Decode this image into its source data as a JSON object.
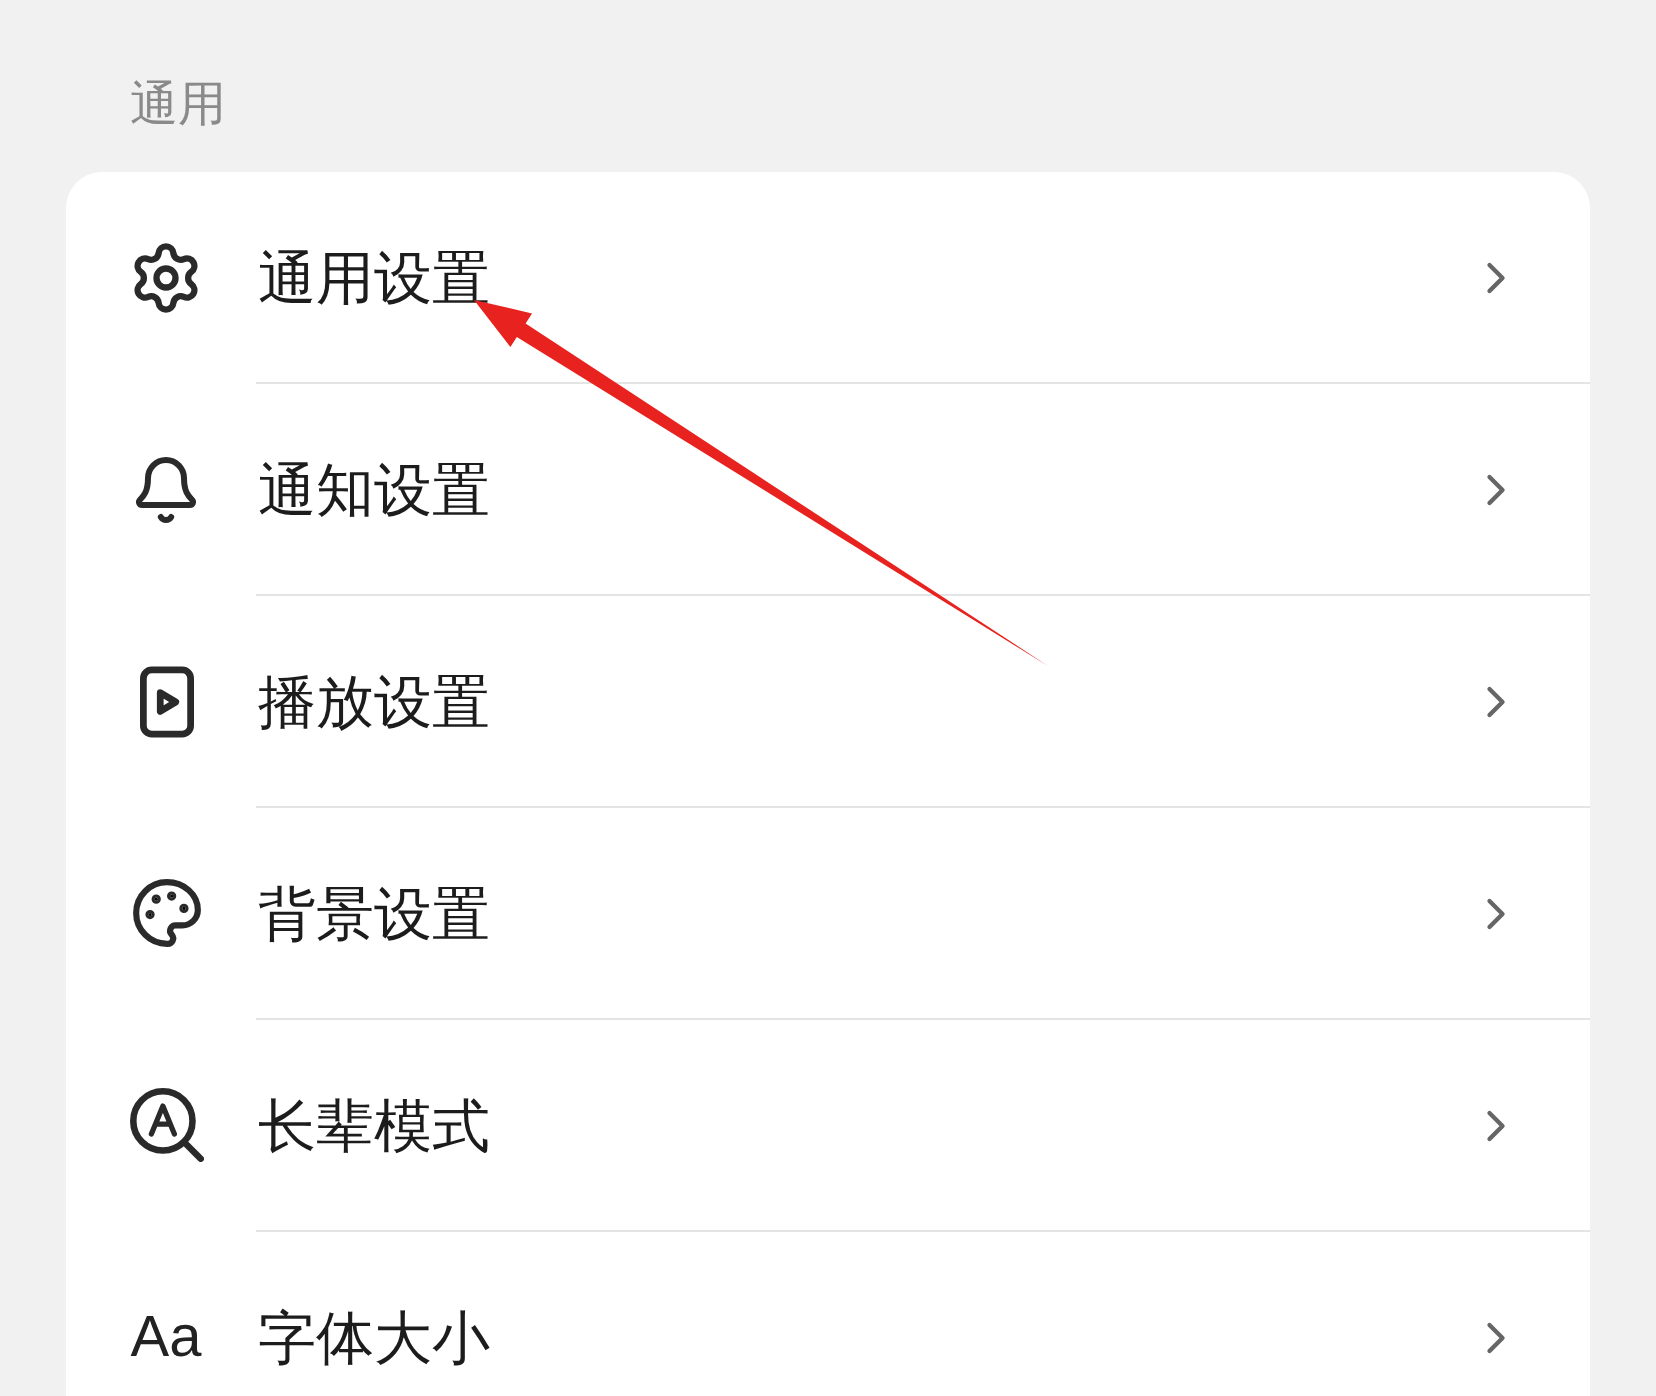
{
  "section": {
    "title": "通用"
  },
  "items": [
    {
      "label": "通用设置"
    },
    {
      "label": "通知设置"
    },
    {
      "label": "播放设置"
    },
    {
      "label": "背景设置"
    },
    {
      "label": "长辈模式"
    },
    {
      "label": "字体大小",
      "icon_text": "Aa"
    }
  ]
}
